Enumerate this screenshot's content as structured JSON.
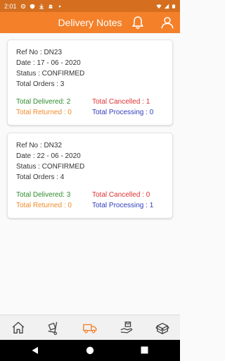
{
  "status_bar": {
    "time": "2:01"
  },
  "header": {
    "title": "Delivery Notes",
    "notifications_icon": "bell-icon",
    "profile_icon": "user-icon"
  },
  "notes": [
    {
      "ref": "Ref No : DN23",
      "date": "Date : 17 - 06 - 2020",
      "status": "Status  : CONFIRMED",
      "orders": "Total Orders : 3",
      "delivered": "Total Delivered: 2",
      "cancelled": "Total Cancelled : 1",
      "returned": "Total Returned  : 0",
      "processing": "Total Processing : 0"
    },
    {
      "ref": "Ref No : DN32",
      "date": "Date : 22 - 06 - 2020",
      "status": "Status  : CONFIRMED",
      "orders": "Total Orders : 4",
      "delivered": "Total Delivered: 3",
      "cancelled": "Total Cancelled : 0",
      "returned": "Total Returned  : 0",
      "processing": "Total Processing : 1"
    }
  ],
  "bottom_nav": [
    "home-icon",
    "dolly-icon",
    "delivery-truck-icon",
    "hand-box-icon",
    "open-box-icon"
  ],
  "colors": {
    "accent": "#f4802a",
    "delivered": "#2e8b2e",
    "cancelled": "#e03131",
    "returned": "#f08a2a",
    "processing": "#2e3dbb"
  }
}
